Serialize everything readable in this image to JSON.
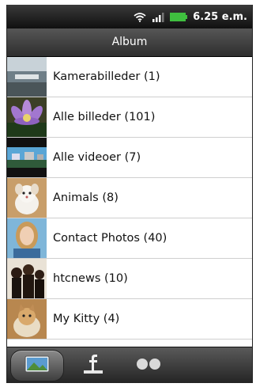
{
  "status_bar": {
    "time": "6.25 e.m."
  },
  "header": {
    "title": "Album"
  },
  "albums": [
    {
      "label": "Kamerabilleder (1)",
      "thumb_icon": "camera-thumbnail"
    },
    {
      "label": "Alle billeder (101)",
      "thumb_icon": "flower-thumbnail"
    },
    {
      "label": "Alle videoer (7)",
      "thumb_icon": "video-thumbnail"
    },
    {
      "label": "Animals (8)",
      "thumb_icon": "animal-thumbnail"
    },
    {
      "label": "Contact Photos (40)",
      "thumb_icon": "contact-thumbnail"
    },
    {
      "label": "htcnews (10)",
      "thumb_icon": "people-thumbnail"
    },
    {
      "label": "My Kitty (4)",
      "thumb_icon": "kitty-thumbnail"
    }
  ],
  "bottom_tabs": [
    {
      "icon": "album-icon",
      "active": true
    },
    {
      "icon": "facebook-icon",
      "active": false
    },
    {
      "icon": "flickr-icon",
      "active": false
    }
  ],
  "colors": {
    "title_bar": "#3e3e3e",
    "status_bar": "#1a1a1a",
    "divider": "#cfcfcf"
  }
}
